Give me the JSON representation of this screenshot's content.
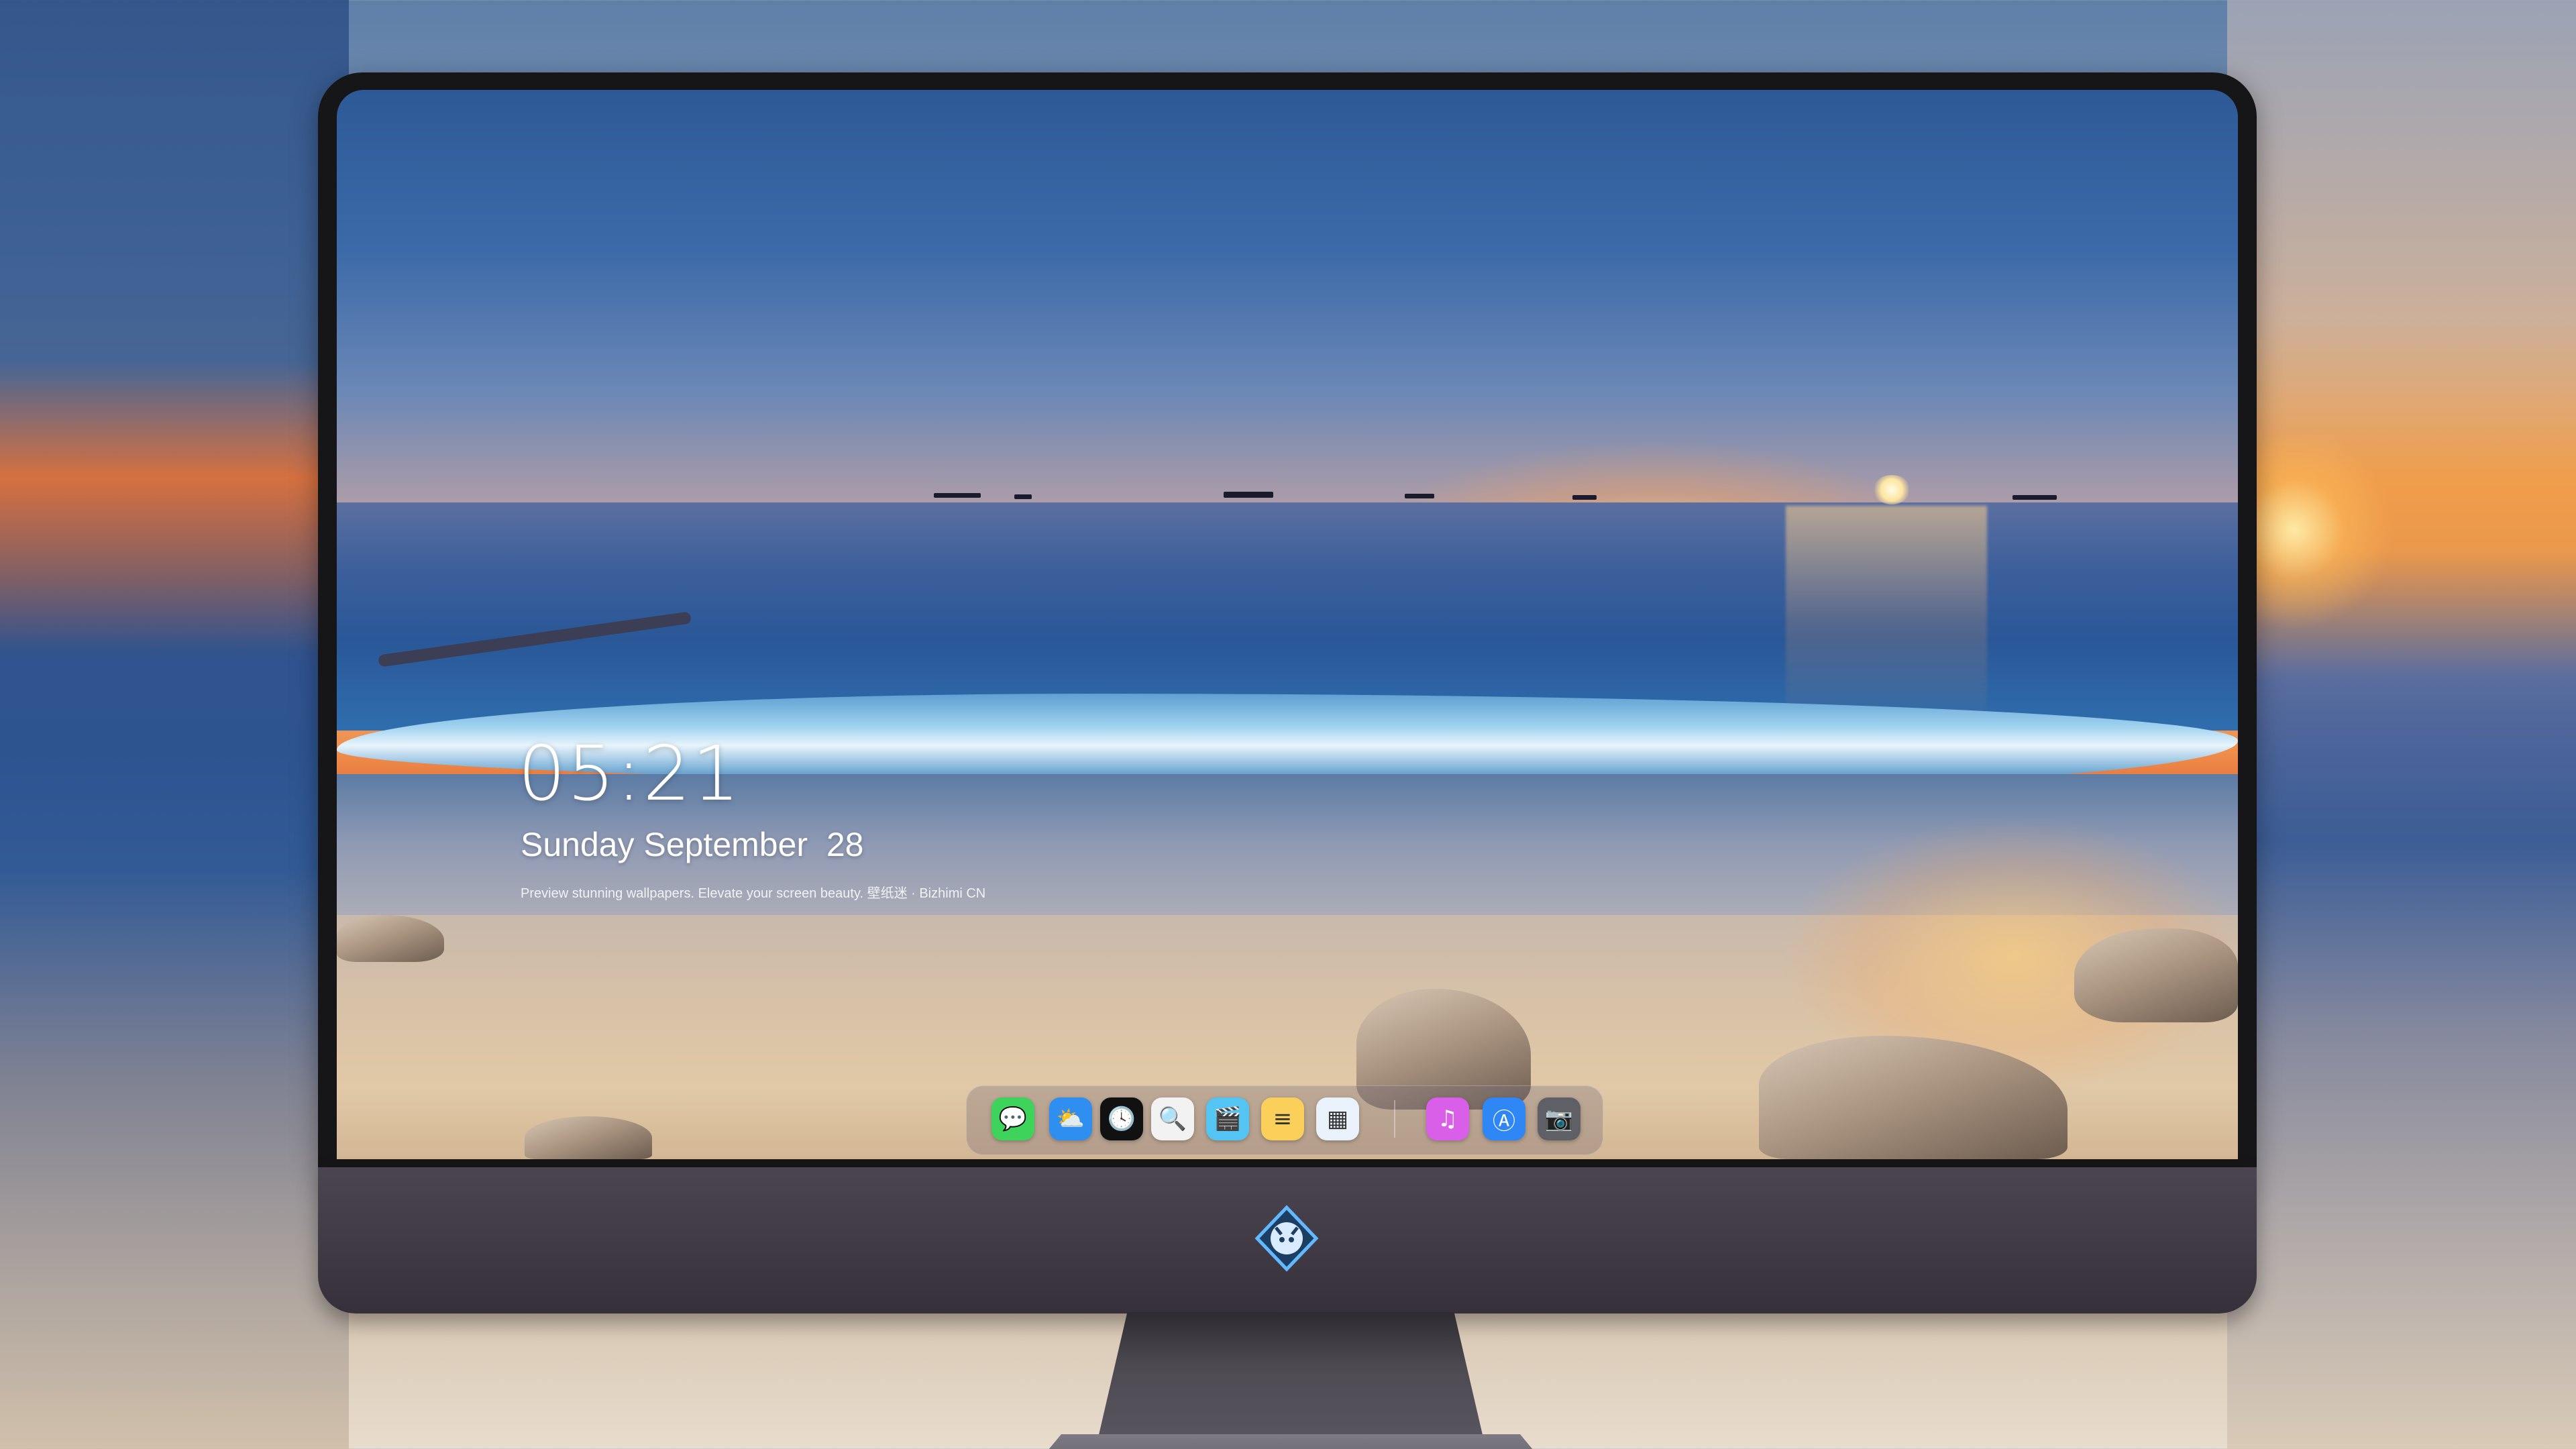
{
  "wallpaper": {
    "time": "05:21",
    "date": "Sunday September  28",
    "tagline": "Preview stunning wallpapers. Elevate your screen beauty. 壁纸迷 · Bizhimi CN"
  },
  "dock": {
    "items": [
      {
        "name": "messages-icon",
        "glyph": "💬",
        "color": "#3ed35a"
      },
      {
        "name": "weather-icon",
        "glyph": "⛅",
        "color": "#2f8ff0"
      },
      {
        "name": "clock-icon",
        "glyph": "🕓",
        "color": "#111111"
      },
      {
        "name": "preview-icon",
        "glyph": "🔍",
        "color": "#f2f2f2"
      },
      {
        "name": "clips-icon",
        "glyph": "🎬",
        "color": "#54c4f2"
      },
      {
        "name": "notes-icon",
        "glyph": "≡",
        "color": "#fbd05a"
      },
      {
        "name": "photo-grid-icon",
        "glyph": "▦",
        "color": "#e9f1fb"
      },
      {
        "name": "music-icon",
        "glyph": "♫",
        "color": "#d95ee8"
      },
      {
        "name": "app-store-icon",
        "glyph": "Ⓐ",
        "color": "#2f86f5"
      },
      {
        "name": "camera-icon",
        "glyph": "📷",
        "color": "#5f5f66"
      }
    ]
  }
}
